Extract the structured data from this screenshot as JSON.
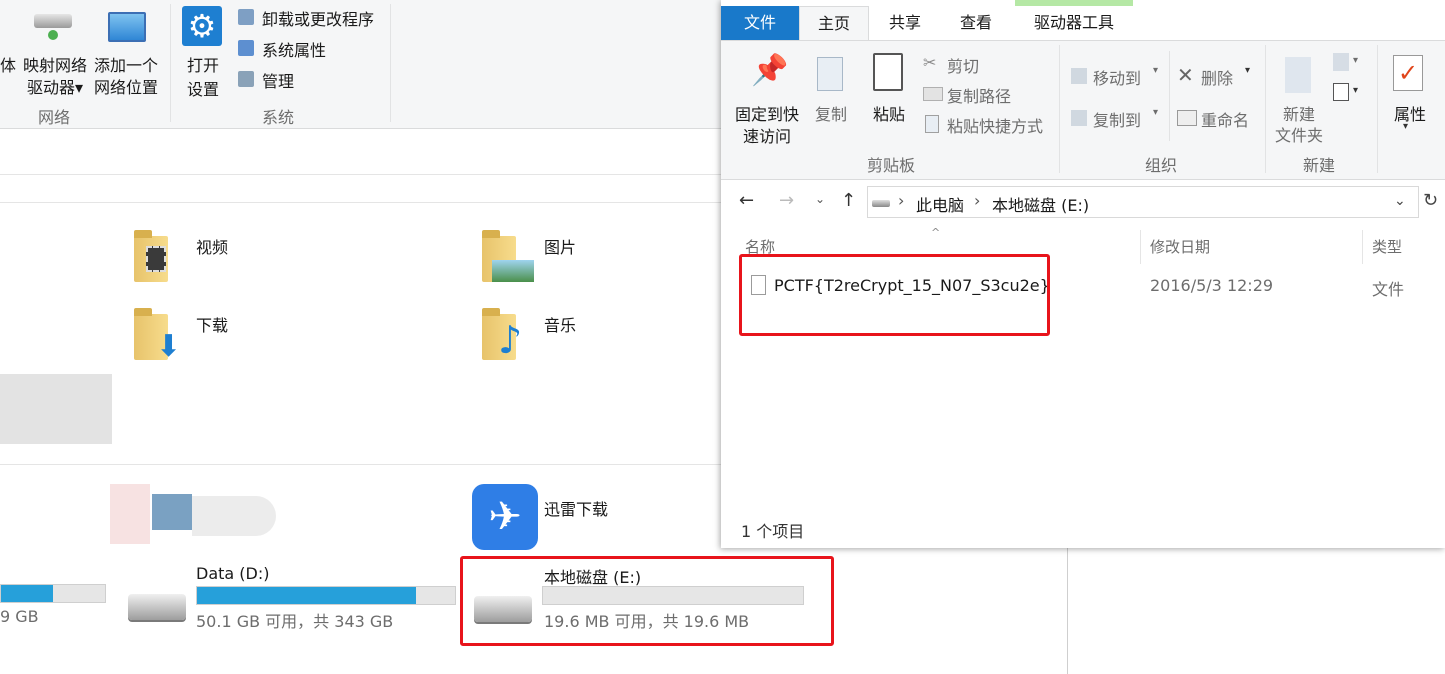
{
  "bg_ribbon": {
    "network_group": {
      "partial_label": "体",
      "map_drive": [
        "映射网络",
        "驱动器▾"
      ],
      "add_location": [
        "添加一个",
        "网络位置"
      ],
      "group_label": "网络"
    },
    "system_group": {
      "open_settings": [
        "打开",
        "设置"
      ],
      "uninstall": "卸载或更改程序",
      "sys_props": "系统属性",
      "manage": "管理",
      "group_label": "系统"
    }
  },
  "bg_content": {
    "folders": [
      {
        "label": "视频",
        "icon": "video-folder-icon"
      },
      {
        "label": "图片",
        "icon": "pictures-folder-icon"
      },
      {
        "label": "下载",
        "icon": "downloads-folder-icon"
      },
      {
        "label": "音乐",
        "icon": "music-folder-icon"
      }
    ],
    "xunlei_label": "迅雷下载",
    "drives": [
      {
        "name": "",
        "free_text": "9 GB",
        "fill": 0.5
      },
      {
        "name": "Data (D:)",
        "free_text": "50.1 GB 可用，共 343 GB",
        "fill": 0.85
      },
      {
        "name": "本地磁盘 (E:)",
        "free_text": "19.6 MB 可用，共 19.6 MB",
        "fill": 0.0
      }
    ]
  },
  "fg": {
    "tabs": {
      "file": "文件",
      "home": "主页",
      "share": "共享",
      "view": "查看",
      "drive_tools": "驱动器工具"
    },
    "ribbon": {
      "pin": [
        "固定到快",
        "速访问"
      ],
      "copy": "复制",
      "paste": "粘贴",
      "cut": "剪切",
      "copy_path": "复制路径",
      "paste_shortcut": "粘贴快捷方式",
      "clipboard_label": "剪贴板",
      "move_to": "移动到",
      "copy_to": "复制到",
      "delete": "删除",
      "rename": "重命名",
      "organize_label": "组织",
      "new_folder": [
        "新建",
        "文件夹"
      ],
      "new_label": "新建",
      "properties": "属性"
    },
    "address": {
      "this_pc": "此电脑",
      "drive": "本地磁盘 (E:)"
    },
    "columns": {
      "name": "名称",
      "modified": "修改日期",
      "type": "类型"
    },
    "files": [
      {
        "name": "PCTF{T2reCrypt_15_N07_S3cu2e}",
        "modified": "2016/5/3 12:29",
        "type": "文件"
      }
    ],
    "status": "1 个项目"
  },
  "colors": {
    "accent": "#1e7fd1",
    "file_tab": "#1979ca",
    "drive_tools_tab": "#b5e8a5",
    "highlight_box": "#e8141b",
    "bar_fill": "#26a0da"
  }
}
